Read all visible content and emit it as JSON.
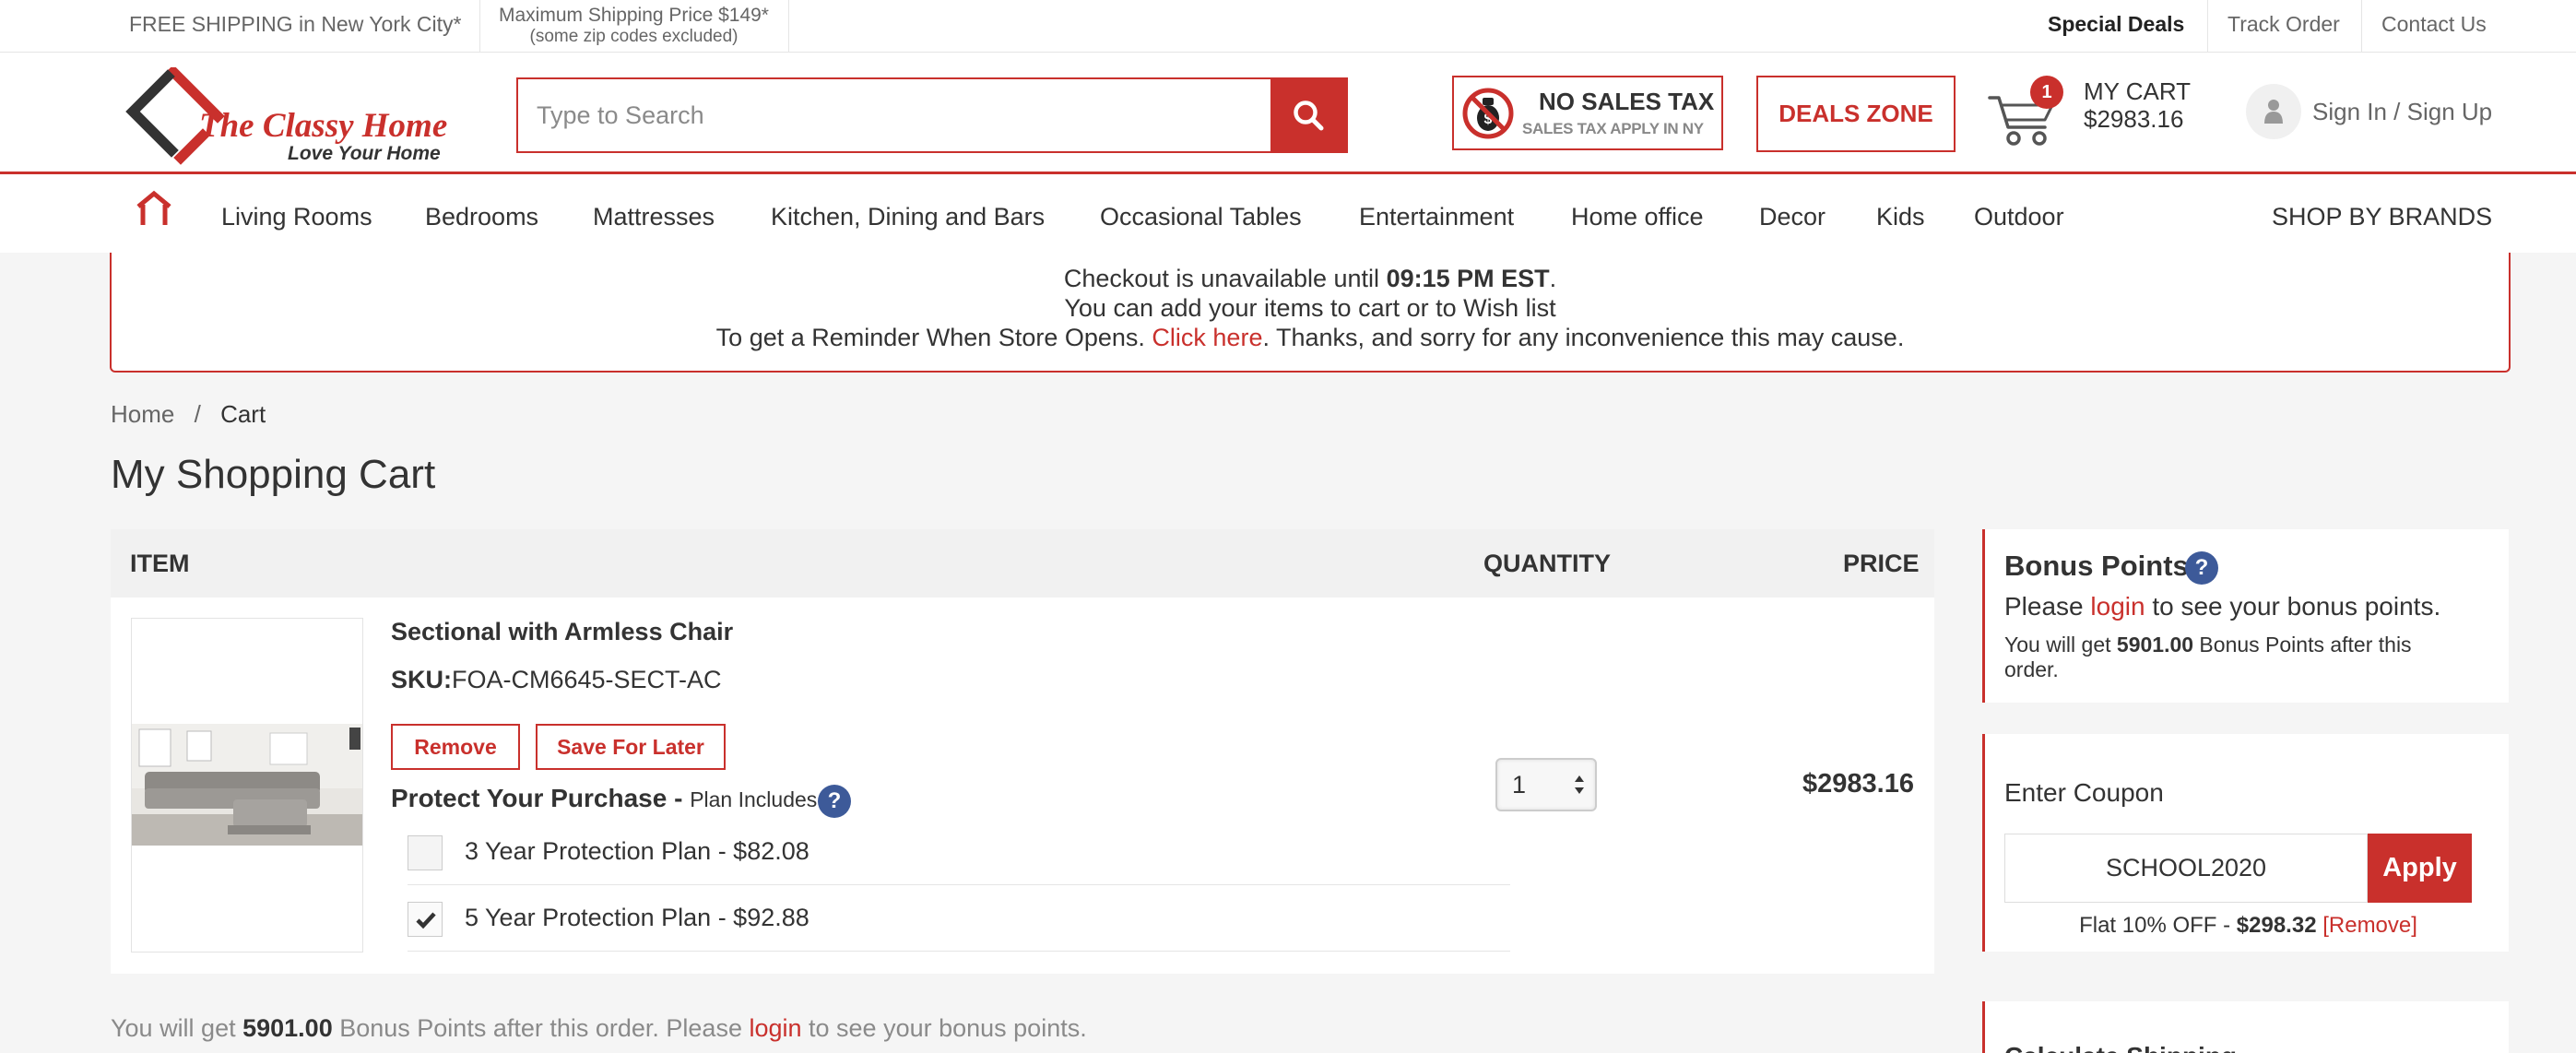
{
  "topbar": {
    "shipping": "FREE SHIPPING in New York City*",
    "max_price": "Maximum Shipping Price $149*",
    "max_note": "(some zip codes excluded)",
    "links": [
      "Special Deals",
      "Track Order",
      "Contact Us"
    ]
  },
  "header": {
    "logo_name": "The Classy Home",
    "logo_tagline": "Love Your Home",
    "search_placeholder": "Type to Search",
    "no_tax_title": "NO SALES TAX",
    "no_tax_sub": "SALES TAX APPLY IN NY",
    "deals_label": "DEALS ZONE",
    "cart_count": "1",
    "cart_label": "MY CART",
    "cart_total": "$2983.16",
    "signin_label": "Sign In / Sign Up"
  },
  "nav": {
    "items": [
      "Living Rooms",
      "Bedrooms",
      "Mattresses",
      "Kitchen, Dining and Bars",
      "Occasional Tables",
      "Entertainment",
      "Home office",
      "Decor",
      "Kids",
      "Outdoor"
    ],
    "brands": "SHOP BY BRANDS"
  },
  "notice": {
    "line1_pre": "Checkout is unavailable until ",
    "line1_time": "09:15 PM EST",
    "line1_post": ".",
    "line2": "You can add your items to cart or to Wish list",
    "line3_pre": "To get a Reminder When Store Opens. ",
    "line3_link": "Click here",
    "line3_post": ". Thanks, and sorry for any inconvenience this may cause."
  },
  "breadcrumb": {
    "home": "Home",
    "sep": "/",
    "current": "Cart"
  },
  "page_title": "My Shopping Cart",
  "table": {
    "headers": {
      "item": "ITEM",
      "quantity": "QUANTITY",
      "price": "PRICE"
    }
  },
  "cart_item": {
    "name": "Sectional with Armless Chair",
    "sku_label": "SKU:",
    "sku": "FOA-CM6645-SECT-AC",
    "remove_label": "Remove",
    "save_label": "Save For Later",
    "protect_title": "Protect Your Purchase - ",
    "protect_sub": "Plan Includes",
    "plans": [
      {
        "label": "3 Year Protection Plan - $82.08",
        "checked": false
      },
      {
        "label": "5 Year Protection Plan - $92.88",
        "checked": true
      }
    ],
    "quantity": "1",
    "price": "$2983.16"
  },
  "bonus_line": {
    "pre": "You will get ",
    "points": "5901.00",
    "mid": " Bonus Points after this order. Please ",
    "link": "login",
    "post": " to see your bonus points."
  },
  "bonus_panel": {
    "title": "Bonus Points",
    "line1_pre": "Please ",
    "line1_link": "login",
    "line1_post": " to see your bonus points.",
    "line2_pre": "You will get ",
    "line2_points": "5901.00",
    "line2_post": " Bonus Points after this order."
  },
  "coupon_panel": {
    "title": "Enter Coupon",
    "code": "SCHOOL2020",
    "apply_label": "Apply",
    "discount_pre": "Flat 10% OFF - ",
    "discount_amount": "$298.32",
    "remove_link": "[Remove]"
  },
  "shipping_panel": {
    "title": "Calculate Shipping"
  },
  "colors": {
    "accent": "#c9302c",
    "help": "#3d5a99"
  }
}
